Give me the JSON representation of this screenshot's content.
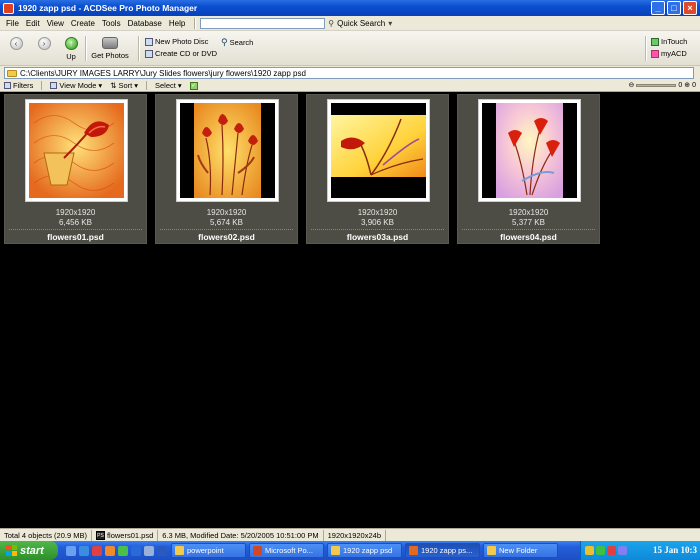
{
  "window": {
    "title": "1920 zapp psd - ACDSee Pro Photo Manager",
    "buttons": {
      "minimize": "_",
      "maximize": "□",
      "close": "×"
    }
  },
  "menu": {
    "items": [
      "File",
      "Edit",
      "View",
      "Create",
      "Tools",
      "Database",
      "Help"
    ],
    "quick_search_label": "Quick Search",
    "quick_search_value": ""
  },
  "toolbar": {
    "up_label": "Up",
    "get_photos_label": "Get Photos",
    "new_photo_disc": "New Photo Disc",
    "create_cd_dvd": "Create CD or DVD",
    "search": "Search",
    "intouch": "InTouch",
    "myacd": "myACD"
  },
  "address": {
    "path": "C:\\Clients\\JURY IMAGES LARRY\\Jury Slides flowers\\jury flowers\\1920 zapp psd"
  },
  "filterbar": {
    "filters": "Filters",
    "view_mode": "View Mode",
    "sort": "Sort",
    "select": "Select",
    "zoom_min": "0",
    "zoom_max": "0"
  },
  "files": [
    {
      "dims": "1920x1920",
      "size": "6,456 KB",
      "name": "flowers01.psd"
    },
    {
      "dims": "1920x1920",
      "size": "5,674 KB",
      "name": "flowers02.psd"
    },
    {
      "dims": "1920x1920",
      "size": "3,906 KB",
      "name": "flowers03a.psd"
    },
    {
      "dims": "1920x1920",
      "size": "5,377 KB",
      "name": "flowers04.psd"
    }
  ],
  "status": {
    "total": "Total 4 objects  (20.9 MB)",
    "file": "flowers01.psd",
    "info": "6.3 MB, Modified Date: 5/20/2005 10:51:00 PM",
    "dims": "1920x1920x24b"
  },
  "taskbar": {
    "start": "start",
    "buttons": [
      "powerpoint",
      "Microsoft Po...",
      "1920 zapp psd",
      "1920 zapp ps...",
      "New Folder"
    ],
    "clock": "15 Jan 10:3"
  },
  "colors": {
    "thumb_bg": "#4e4d45",
    "titlebar": "#0a4fd0",
    "taskbar": "#245edb",
    "start_green": "#3fa33b"
  }
}
